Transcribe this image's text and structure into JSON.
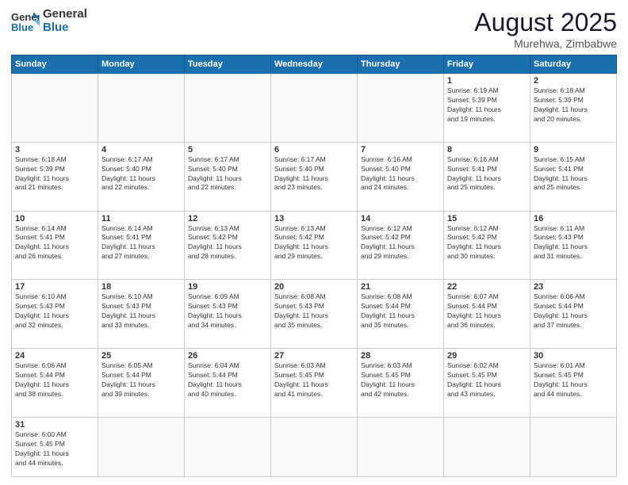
{
  "header": {
    "logo_general": "General",
    "logo_blue": "Blue",
    "title": "August 2025",
    "subtitle": "Murehwa, Zimbabwe"
  },
  "weekdays": [
    "Sunday",
    "Monday",
    "Tuesday",
    "Wednesday",
    "Thursday",
    "Friday",
    "Saturday"
  ],
  "weeks": [
    [
      {
        "day": "",
        "info": ""
      },
      {
        "day": "",
        "info": ""
      },
      {
        "day": "",
        "info": ""
      },
      {
        "day": "",
        "info": ""
      },
      {
        "day": "",
        "info": ""
      },
      {
        "day": "1",
        "info": "Sunrise: 6:19 AM\nSunset: 5:39 PM\nDaylight: 11 hours\nand 19 minutes."
      },
      {
        "day": "2",
        "info": "Sunrise: 6:18 AM\nSunset: 5:39 PM\nDaylight: 11 hours\nand 20 minutes."
      }
    ],
    [
      {
        "day": "3",
        "info": "Sunrise: 6:18 AM\nSunset: 5:39 PM\nDaylight: 11 hours\nand 21 minutes."
      },
      {
        "day": "4",
        "info": "Sunrise: 6:17 AM\nSunset: 5:40 PM\nDaylight: 11 hours\nand 22 minutes."
      },
      {
        "day": "5",
        "info": "Sunrise: 6:17 AM\nSunset: 5:40 PM\nDaylight: 11 hours\nand 22 minutes."
      },
      {
        "day": "6",
        "info": "Sunrise: 6:17 AM\nSunset: 5:40 PM\nDaylight: 11 hours\nand 23 minutes."
      },
      {
        "day": "7",
        "info": "Sunrise: 6:16 AM\nSunset: 5:40 PM\nDaylight: 11 hours\nand 24 minutes."
      },
      {
        "day": "8",
        "info": "Sunrise: 6:16 AM\nSunset: 5:41 PM\nDaylight: 11 hours\nand 25 minutes."
      },
      {
        "day": "9",
        "info": "Sunrise: 6:15 AM\nSunset: 5:41 PM\nDaylight: 11 hours\nand 25 minutes."
      }
    ],
    [
      {
        "day": "10",
        "info": "Sunrise: 6:14 AM\nSunset: 5:41 PM\nDaylight: 11 hours\nand 26 minutes."
      },
      {
        "day": "11",
        "info": "Sunrise: 6:14 AM\nSunset: 5:41 PM\nDaylight: 11 hours\nand 27 minutes."
      },
      {
        "day": "12",
        "info": "Sunrise: 6:13 AM\nSunset: 5:42 PM\nDaylight: 11 hours\nand 28 minutes."
      },
      {
        "day": "13",
        "info": "Sunrise: 6:13 AM\nSunset: 5:42 PM\nDaylight: 11 hours\nand 29 minutes."
      },
      {
        "day": "14",
        "info": "Sunrise: 6:12 AM\nSunset: 5:42 PM\nDaylight: 11 hours\nand 29 minutes."
      },
      {
        "day": "15",
        "info": "Sunrise: 6:12 AM\nSunset: 5:42 PM\nDaylight: 11 hours\nand 30 minutes."
      },
      {
        "day": "16",
        "info": "Sunrise: 6:11 AM\nSunset: 5:43 PM\nDaylight: 11 hours\nand 31 minutes."
      }
    ],
    [
      {
        "day": "17",
        "info": "Sunrise: 6:10 AM\nSunset: 5:43 PM\nDaylight: 11 hours\nand 32 minutes."
      },
      {
        "day": "18",
        "info": "Sunrise: 6:10 AM\nSunset: 5:43 PM\nDaylight: 11 hours\nand 33 minutes."
      },
      {
        "day": "19",
        "info": "Sunrise: 6:09 AM\nSunset: 5:43 PM\nDaylight: 11 hours\nand 34 minutes."
      },
      {
        "day": "20",
        "info": "Sunrise: 6:08 AM\nSunset: 5:43 PM\nDaylight: 11 hours\nand 35 minutes."
      },
      {
        "day": "21",
        "info": "Sunrise: 6:08 AM\nSunset: 5:44 PM\nDaylight: 11 hours\nand 35 minutes."
      },
      {
        "day": "22",
        "info": "Sunrise: 6:07 AM\nSunset: 5:44 PM\nDaylight: 11 hours\nand 36 minutes."
      },
      {
        "day": "23",
        "info": "Sunrise: 6:06 AM\nSunset: 5:44 PM\nDaylight: 11 hours\nand 37 minutes."
      }
    ],
    [
      {
        "day": "24",
        "info": "Sunrise: 6:06 AM\nSunset: 5:44 PM\nDaylight: 11 hours\nand 38 minutes."
      },
      {
        "day": "25",
        "info": "Sunrise: 6:05 AM\nSunset: 5:44 PM\nDaylight: 11 hours\nand 39 minutes."
      },
      {
        "day": "26",
        "info": "Sunrise: 6:04 AM\nSunset: 5:44 PM\nDaylight: 11 hours\nand 40 minutes."
      },
      {
        "day": "27",
        "info": "Sunrise: 6:03 AM\nSunset: 5:45 PM\nDaylight: 11 hours\nand 41 minutes."
      },
      {
        "day": "28",
        "info": "Sunrise: 6:03 AM\nSunset: 5:45 PM\nDaylight: 11 hours\nand 42 minutes."
      },
      {
        "day": "29",
        "info": "Sunrise: 6:02 AM\nSunset: 5:45 PM\nDaylight: 11 hours\nand 43 minutes."
      },
      {
        "day": "30",
        "info": "Sunrise: 6:01 AM\nSunset: 5:45 PM\nDaylight: 11 hours\nand 44 minutes."
      }
    ],
    [
      {
        "day": "31",
        "info": "Sunrise: 6:00 AM\nSunset: 5:45 PM\nDaylight: 11 hours\nand 44 minutes."
      },
      {
        "day": "",
        "info": ""
      },
      {
        "day": "",
        "info": ""
      },
      {
        "day": "",
        "info": ""
      },
      {
        "day": "",
        "info": ""
      },
      {
        "day": "",
        "info": ""
      },
      {
        "day": "",
        "info": ""
      }
    ]
  ]
}
